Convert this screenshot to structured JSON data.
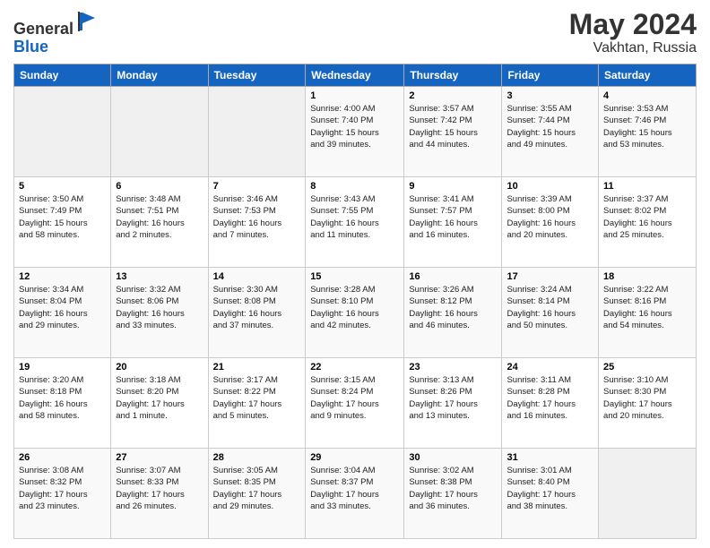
{
  "header": {
    "logo_line1": "General",
    "logo_line2": "Blue",
    "title": "May 2024",
    "location": "Vakhtan, Russia"
  },
  "days_of_week": [
    "Sunday",
    "Monday",
    "Tuesday",
    "Wednesday",
    "Thursday",
    "Friday",
    "Saturday"
  ],
  "weeks": [
    [
      {
        "day": "",
        "info": ""
      },
      {
        "day": "",
        "info": ""
      },
      {
        "day": "",
        "info": ""
      },
      {
        "day": "1",
        "info": "Sunrise: 4:00 AM\nSunset: 7:40 PM\nDaylight: 15 hours\nand 39 minutes."
      },
      {
        "day": "2",
        "info": "Sunrise: 3:57 AM\nSunset: 7:42 PM\nDaylight: 15 hours\nand 44 minutes."
      },
      {
        "day": "3",
        "info": "Sunrise: 3:55 AM\nSunset: 7:44 PM\nDaylight: 15 hours\nand 49 minutes."
      },
      {
        "day": "4",
        "info": "Sunrise: 3:53 AM\nSunset: 7:46 PM\nDaylight: 15 hours\nand 53 minutes."
      }
    ],
    [
      {
        "day": "5",
        "info": "Sunrise: 3:50 AM\nSunset: 7:49 PM\nDaylight: 15 hours\nand 58 minutes."
      },
      {
        "day": "6",
        "info": "Sunrise: 3:48 AM\nSunset: 7:51 PM\nDaylight: 16 hours\nand 2 minutes."
      },
      {
        "day": "7",
        "info": "Sunrise: 3:46 AM\nSunset: 7:53 PM\nDaylight: 16 hours\nand 7 minutes."
      },
      {
        "day": "8",
        "info": "Sunrise: 3:43 AM\nSunset: 7:55 PM\nDaylight: 16 hours\nand 11 minutes."
      },
      {
        "day": "9",
        "info": "Sunrise: 3:41 AM\nSunset: 7:57 PM\nDaylight: 16 hours\nand 16 minutes."
      },
      {
        "day": "10",
        "info": "Sunrise: 3:39 AM\nSunset: 8:00 PM\nDaylight: 16 hours\nand 20 minutes."
      },
      {
        "day": "11",
        "info": "Sunrise: 3:37 AM\nSunset: 8:02 PM\nDaylight: 16 hours\nand 25 minutes."
      }
    ],
    [
      {
        "day": "12",
        "info": "Sunrise: 3:34 AM\nSunset: 8:04 PM\nDaylight: 16 hours\nand 29 minutes."
      },
      {
        "day": "13",
        "info": "Sunrise: 3:32 AM\nSunset: 8:06 PM\nDaylight: 16 hours\nand 33 minutes."
      },
      {
        "day": "14",
        "info": "Sunrise: 3:30 AM\nSunset: 8:08 PM\nDaylight: 16 hours\nand 37 minutes."
      },
      {
        "day": "15",
        "info": "Sunrise: 3:28 AM\nSunset: 8:10 PM\nDaylight: 16 hours\nand 42 minutes."
      },
      {
        "day": "16",
        "info": "Sunrise: 3:26 AM\nSunset: 8:12 PM\nDaylight: 16 hours\nand 46 minutes."
      },
      {
        "day": "17",
        "info": "Sunrise: 3:24 AM\nSunset: 8:14 PM\nDaylight: 16 hours\nand 50 minutes."
      },
      {
        "day": "18",
        "info": "Sunrise: 3:22 AM\nSunset: 8:16 PM\nDaylight: 16 hours\nand 54 minutes."
      }
    ],
    [
      {
        "day": "19",
        "info": "Sunrise: 3:20 AM\nSunset: 8:18 PM\nDaylight: 16 hours\nand 58 minutes."
      },
      {
        "day": "20",
        "info": "Sunrise: 3:18 AM\nSunset: 8:20 PM\nDaylight: 17 hours\nand 1 minute."
      },
      {
        "day": "21",
        "info": "Sunrise: 3:17 AM\nSunset: 8:22 PM\nDaylight: 17 hours\nand 5 minutes."
      },
      {
        "day": "22",
        "info": "Sunrise: 3:15 AM\nSunset: 8:24 PM\nDaylight: 17 hours\nand 9 minutes."
      },
      {
        "day": "23",
        "info": "Sunrise: 3:13 AM\nSunset: 8:26 PM\nDaylight: 17 hours\nand 13 minutes."
      },
      {
        "day": "24",
        "info": "Sunrise: 3:11 AM\nSunset: 8:28 PM\nDaylight: 17 hours\nand 16 minutes."
      },
      {
        "day": "25",
        "info": "Sunrise: 3:10 AM\nSunset: 8:30 PM\nDaylight: 17 hours\nand 20 minutes."
      }
    ],
    [
      {
        "day": "26",
        "info": "Sunrise: 3:08 AM\nSunset: 8:32 PM\nDaylight: 17 hours\nand 23 minutes."
      },
      {
        "day": "27",
        "info": "Sunrise: 3:07 AM\nSunset: 8:33 PM\nDaylight: 17 hours\nand 26 minutes."
      },
      {
        "day": "28",
        "info": "Sunrise: 3:05 AM\nSunset: 8:35 PM\nDaylight: 17 hours\nand 29 minutes."
      },
      {
        "day": "29",
        "info": "Sunrise: 3:04 AM\nSunset: 8:37 PM\nDaylight: 17 hours\nand 33 minutes."
      },
      {
        "day": "30",
        "info": "Sunrise: 3:02 AM\nSunset: 8:38 PM\nDaylight: 17 hours\nand 36 minutes."
      },
      {
        "day": "31",
        "info": "Sunrise: 3:01 AM\nSunset: 8:40 PM\nDaylight: 17 hours\nand 38 minutes."
      },
      {
        "day": "",
        "info": ""
      }
    ]
  ]
}
